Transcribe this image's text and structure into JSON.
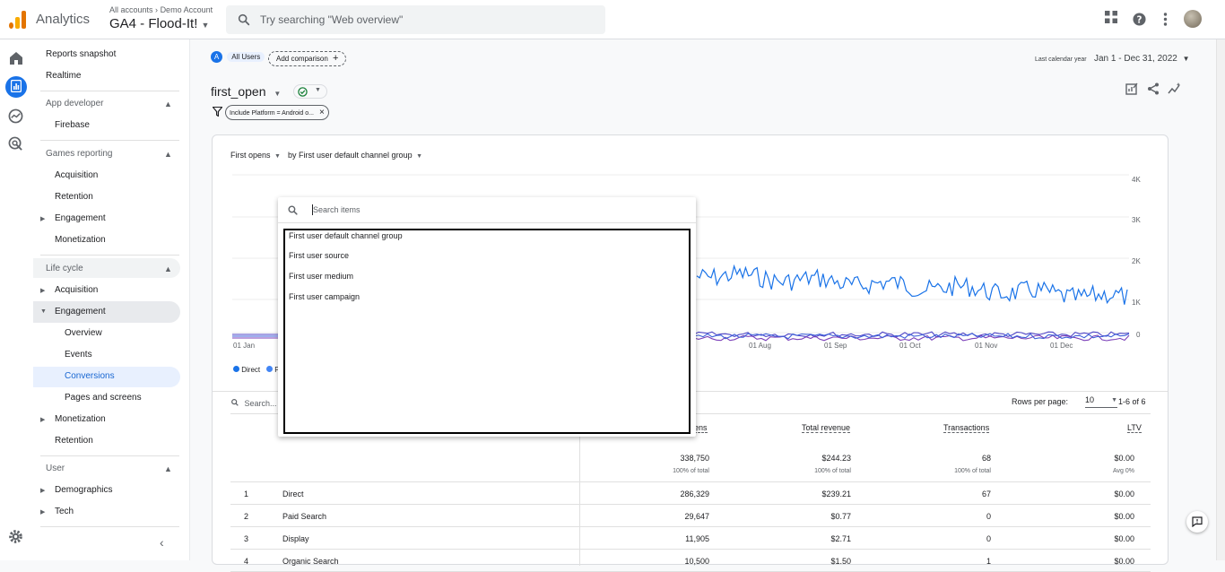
{
  "app": {
    "name": "Analytics",
    "breadcrumb_accounts": "All accounts",
    "breadcrumb_account": "Demo Account",
    "property": "GA4 - Flood-It!"
  },
  "search": {
    "placeholder": "Try searching \"Web overview\""
  },
  "nav": {
    "reports_snapshot": "Reports snapshot",
    "realtime": "Realtime",
    "app_developer": "App developer",
    "firebase": "Firebase",
    "games_reporting": "Games reporting",
    "games_acquisition": "Acquisition",
    "games_retention": "Retention",
    "games_engagement": "Engagement",
    "games_monetization": "Monetization",
    "life_cycle": "Life cycle",
    "lc_acquisition": "Acquisition",
    "lc_engagement": "Engagement",
    "overview": "Overview",
    "events": "Events",
    "conversions": "Conversions",
    "pages_and_screens": "Pages and screens",
    "lc_monetization": "Monetization",
    "lc_retention": "Retention",
    "user": "User",
    "demographics": "Demographics",
    "tech": "Tech"
  },
  "header": {
    "segment_letter": "A",
    "segment": "All Users",
    "add_comparison": "Add comparison",
    "date_label": "Last calendar year",
    "date_range": "Jan 1 - Dec 31, 2022",
    "event_name": "first_open",
    "filter": "Include Platform = Android o..."
  },
  "card": {
    "metric": "First opens",
    "dimension": "by First user default channel group",
    "legend_direct": "Direct",
    "legend_second": "P"
  },
  "chart_data": {
    "type": "line",
    "x_ticks": [
      "01 Jan",
      "01 Aug",
      "01 Sep",
      "01 Oct",
      "01 Nov",
      "01 Dec"
    ],
    "y_ticks": [
      "4K",
      "3K",
      "2K",
      "1K",
      "0"
    ],
    "ylim": [
      0,
      4000
    ],
    "series": [
      {
        "name": "Direct",
        "color": "#1a73e8"
      },
      {
        "name": "P",
        "color": "#4285f4"
      }
    ]
  },
  "table": {
    "search_placeholder": "Search...",
    "rows_per_page_label": "Rows per page:",
    "rows_per_page": "10",
    "pagination": "1-6 of 6",
    "columns": [
      "ens",
      "Total revenue",
      "Transactions",
      "LTV"
    ],
    "totals": {
      "first_opens": "338,750",
      "first_opens_pct": "100% of total",
      "revenue": "$244.23",
      "revenue_pct": "100% of total",
      "transactions": "68",
      "transactions_pct": "100% of total",
      "ltv": "$0.00",
      "ltv_sub": "Avg 0%"
    },
    "rows": [
      {
        "rank": "1",
        "name": "Direct",
        "first_opens": "286,329",
        "revenue": "$239.21",
        "transactions": "67",
        "ltv": "$0.00"
      },
      {
        "rank": "2",
        "name": "Paid Search",
        "first_opens": "29,647",
        "revenue": "$0.77",
        "transactions": "0",
        "ltv": "$0.00"
      },
      {
        "rank": "3",
        "name": "Display",
        "first_opens": "11,905",
        "revenue": "$2.71",
        "transactions": "0",
        "ltv": "$0.00"
      },
      {
        "rank": "4",
        "name": "Organic Search",
        "first_opens": "10,500",
        "revenue": "$1.50",
        "transactions": "1",
        "ltv": "$0.00"
      }
    ]
  },
  "dropdown": {
    "search_placeholder": "Search items",
    "options": [
      "First user default channel group",
      "First user source",
      "First user medium",
      "First user campaign"
    ]
  }
}
